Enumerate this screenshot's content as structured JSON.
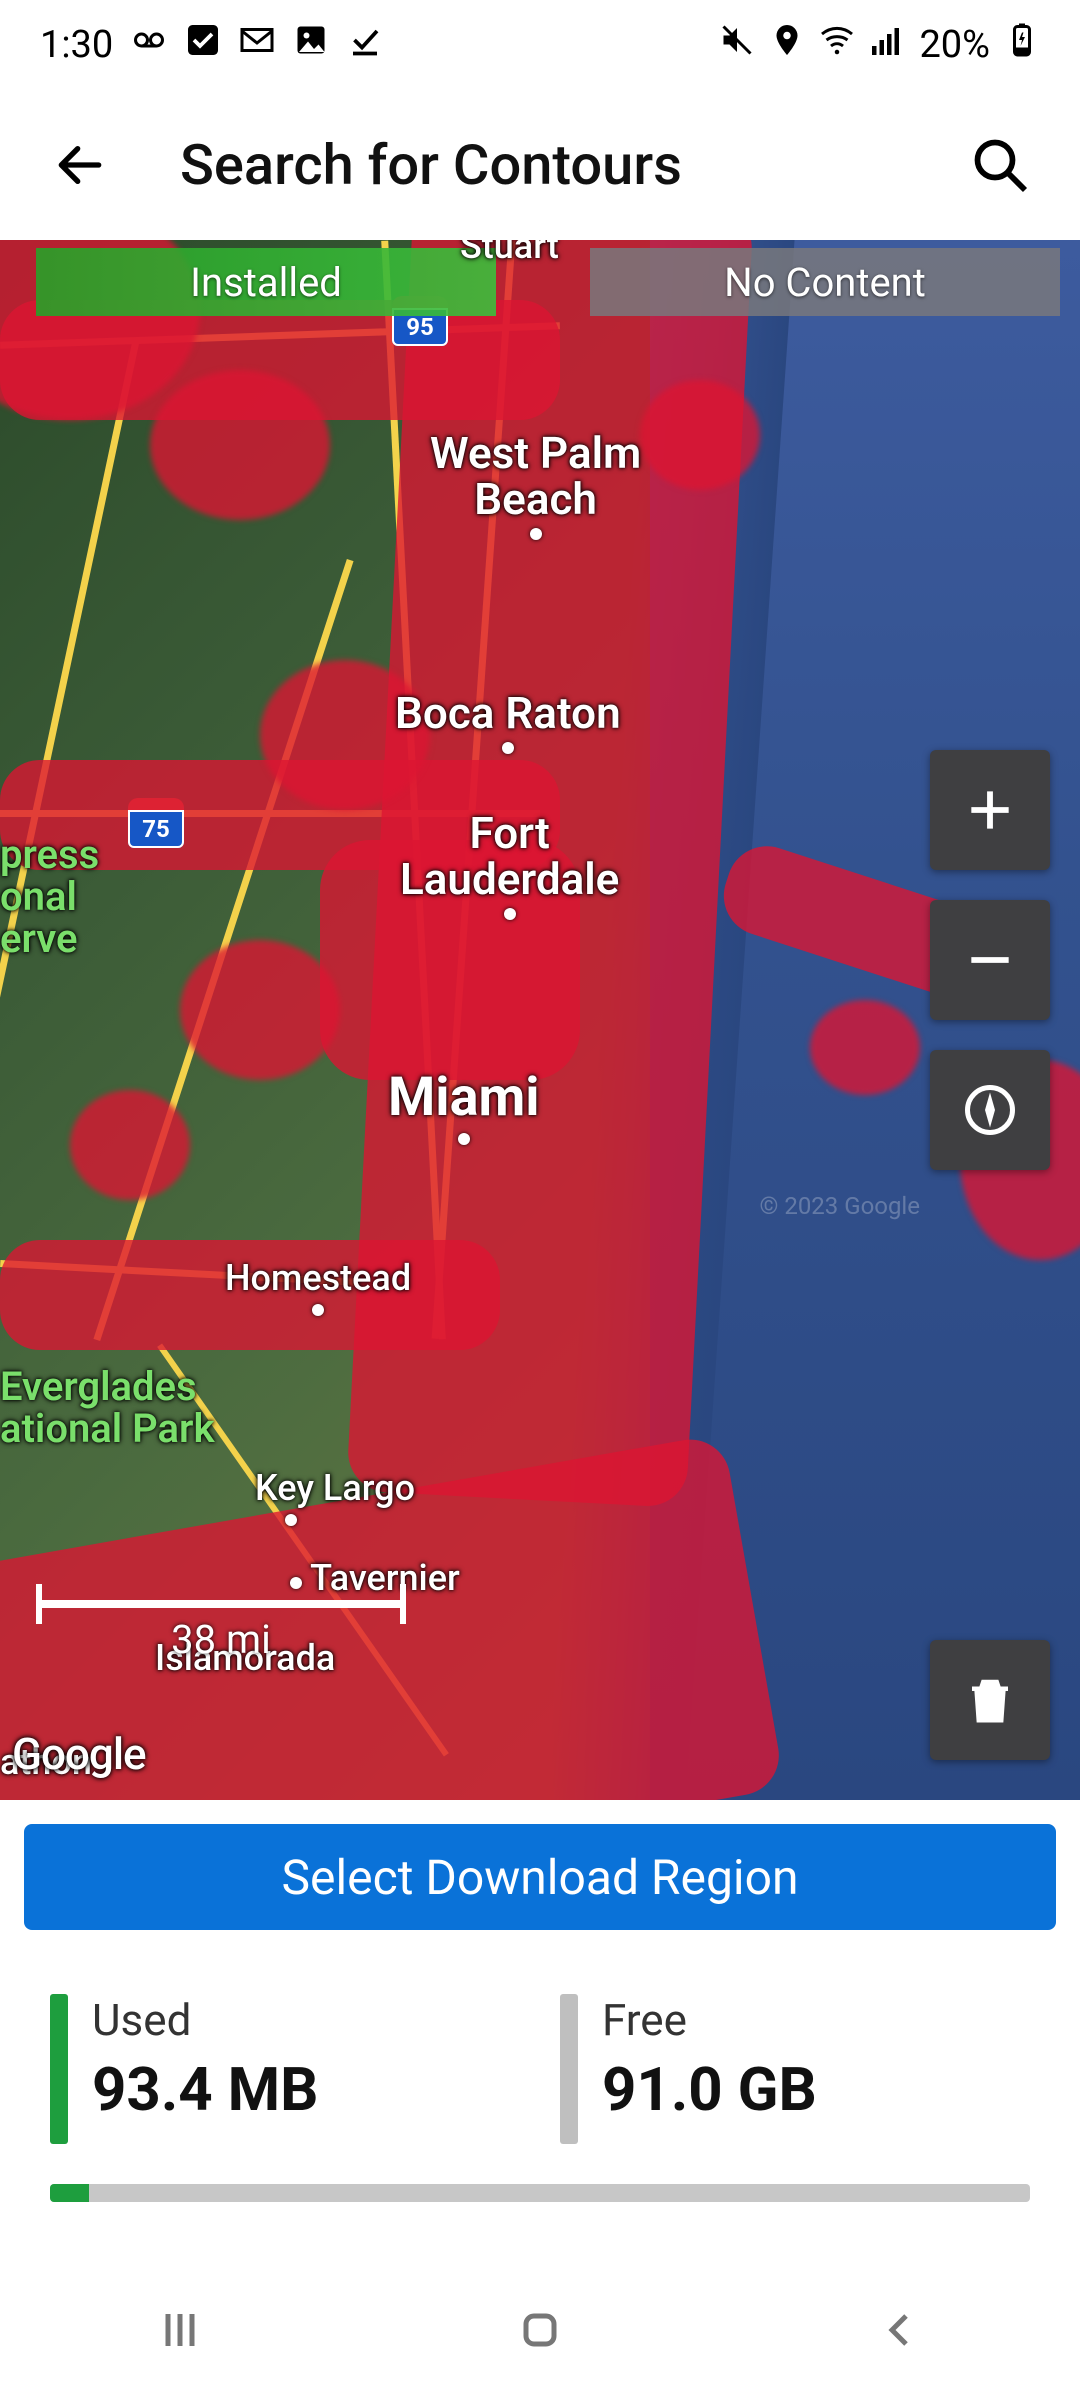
{
  "status": {
    "time": "1:30",
    "battery_text": "20%"
  },
  "header": {
    "title": "Search for Contours"
  },
  "legend": {
    "installed": "Installed",
    "no_content": "No Content"
  },
  "map": {
    "places": {
      "stuart": "Stuart",
      "wpb_l1": "West Palm",
      "wpb_l2": "Beach",
      "boca": "Boca Raton",
      "ftl_l1": "Fort",
      "ftl_l2": "Lauderdale",
      "miami": "Miami",
      "homestead": "Homestead",
      "keylargo": "Key Largo",
      "tavernier": "Tavernier",
      "islamorada": "Islamorada",
      "marathon_frag": "athon"
    },
    "parks": {
      "cypress_l1": "press",
      "cypress_l2": "onal",
      "cypress_l3": "erve",
      "everglades_l1": "Everglades",
      "everglades_l2": "ational Park"
    },
    "shields": {
      "i95": "95",
      "i75": "75"
    },
    "scale_label": "38 mi",
    "attribution": "Google",
    "tile_credit": "© 2023 Google"
  },
  "controls": {
    "zoom_in": "+",
    "zoom_out": "−"
  },
  "action": {
    "select_region": "Select Download Region"
  },
  "storage": {
    "used_label": "Used",
    "used_value": "93.4 MB",
    "free_label": "Free",
    "free_value": "91.0 GB"
  }
}
